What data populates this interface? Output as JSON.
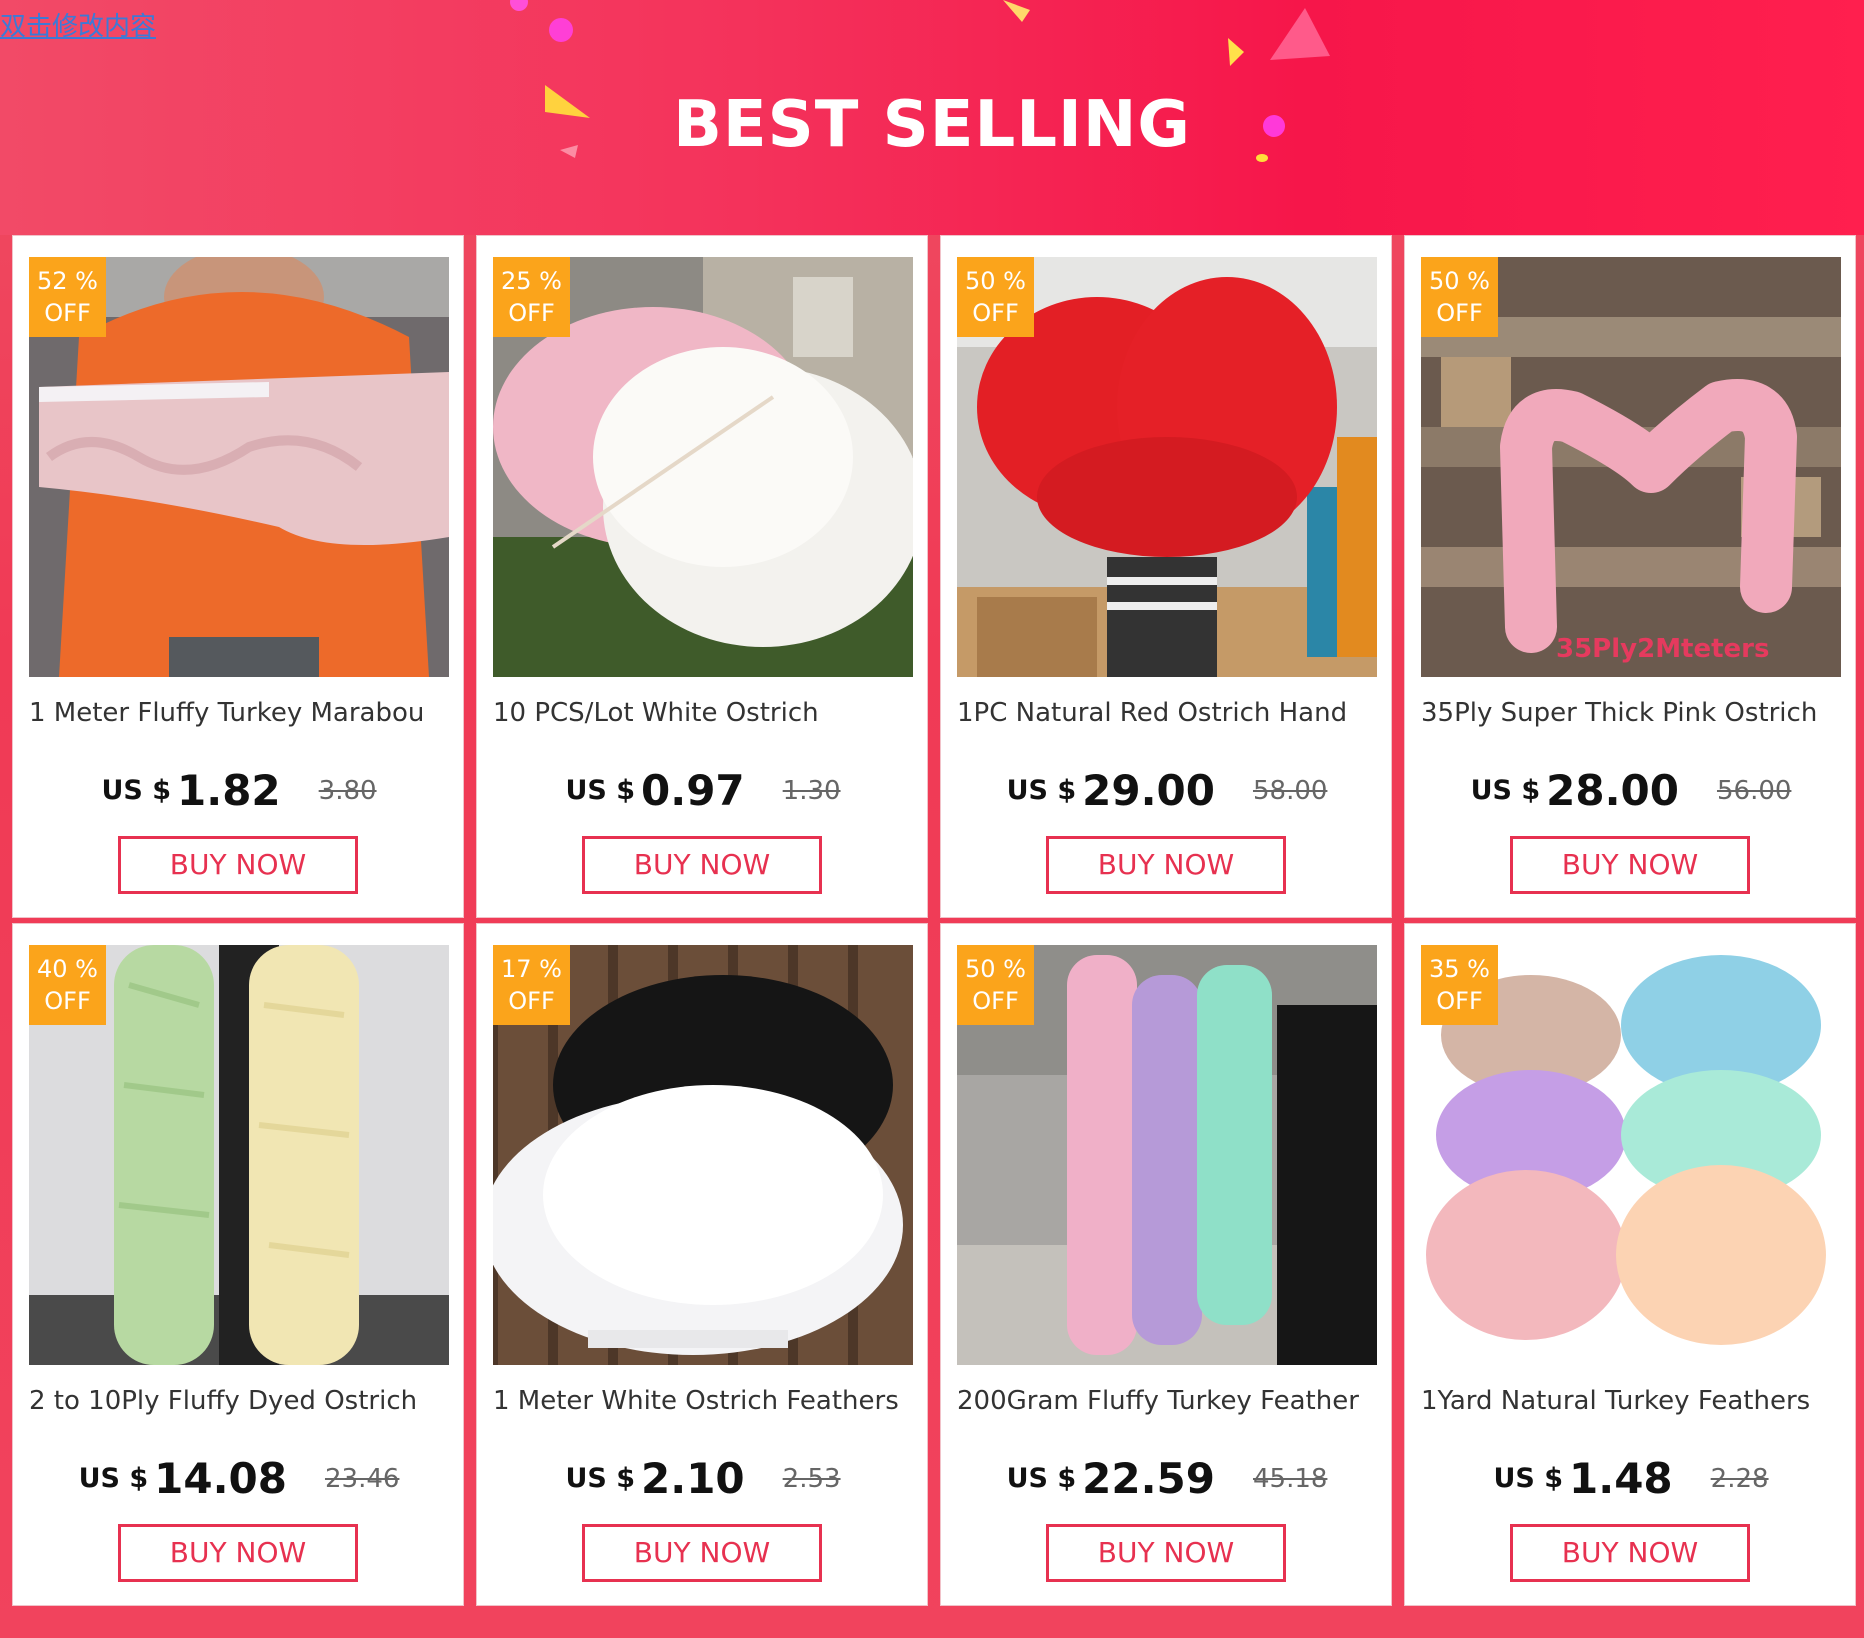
{
  "header": {
    "edit_link": "双击修改内容",
    "title": "BEST SELLING"
  },
  "colors": {
    "accent": "#e73150",
    "badge": "#fba41b",
    "banner": "#f4325b"
  },
  "products": [
    {
      "discount": "52 %",
      "off": "OFF",
      "name": "1 Meter Fluffy Turkey Marabou",
      "currency": "US $",
      "price": "1.82",
      "old_price": "3.80",
      "buy_label": "BUY NOW",
      "image": "pink-turkey-fringe-image",
      "image_caption": ""
    },
    {
      "discount": "25 %",
      "off": "OFF",
      "name": "10 PCS/Lot White Ostrich",
      "currency": "US $",
      "price": "0.97",
      "old_price": "1.30",
      "buy_label": "BUY NOW",
      "image": "white-ostrich-plumes-image",
      "image_caption": ""
    },
    {
      "discount": "50 %",
      "off": "OFF",
      "name": "1PC Natural Red Ostrich Hand",
      "currency": "US $",
      "price": "29.00",
      "old_price": "58.00",
      "buy_label": "BUY NOW",
      "image": "red-ostrich-fan-image",
      "image_caption": ""
    },
    {
      "discount": "50 %",
      "off": "OFF",
      "name": "35Ply Super Thick Pink Ostrich",
      "currency": "US $",
      "price": "28.00",
      "old_price": "56.00",
      "buy_label": "BUY NOW",
      "image": "pink-ostrich-boa-image",
      "image_caption": "35Ply2Mteters"
    },
    {
      "discount": "40 %",
      "off": "OFF",
      "name": "2 to 10Ply Fluffy Dyed Ostrich",
      "currency": "US $",
      "price": "14.08",
      "old_price": "23.46",
      "buy_label": "BUY NOW",
      "image": "green-yellow-boas-image",
      "image_caption": ""
    },
    {
      "discount": "17 %",
      "off": "OFF",
      "name": "1 Meter White Ostrich Feathers",
      "currency": "US $",
      "price": "2.10",
      "old_price": "2.53",
      "buy_label": "BUY NOW",
      "image": "white-black-fringe-image",
      "image_caption": ""
    },
    {
      "discount": "50 %",
      "off": "OFF",
      "name": "200Gram Fluffy Turkey Feather",
      "currency": "US $",
      "price": "22.59",
      "old_price": "45.18",
      "buy_label": "BUY NOW",
      "image": "pastel-turkey-boas-image",
      "image_caption": ""
    },
    {
      "discount": "35 %",
      "off": "OFF",
      "name": "1Yard Natural Turkey Feathers",
      "currency": "US $",
      "price": "1.48",
      "old_price": "2.28",
      "buy_label": "BUY NOW",
      "image": "pastel-feather-bundles-image",
      "image_caption": ""
    }
  ]
}
